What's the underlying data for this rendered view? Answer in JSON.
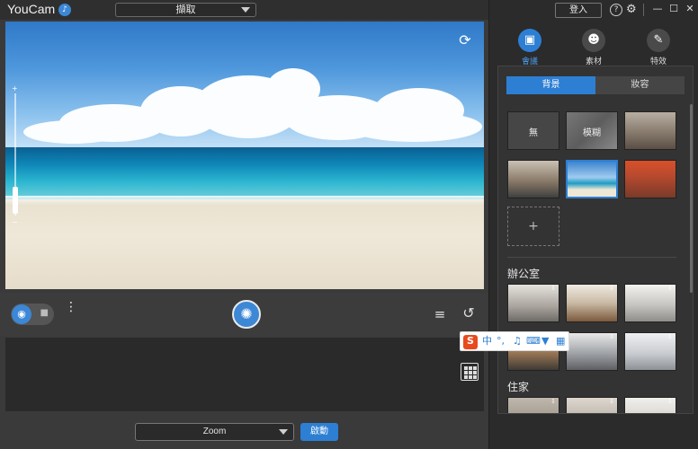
{
  "app": {
    "title": "YouCam"
  },
  "header": {
    "mode": "擷取"
  },
  "window": {
    "login": "登入",
    "help": "?",
    "settings": "⚙",
    "minimize": "—",
    "maximize": "☐",
    "close": "✕"
  },
  "camera": {
    "swap_icon": "camera-switch-icon"
  },
  "controls": {
    "more": "⋮",
    "undo": "↺",
    "layers": "≡"
  },
  "bottom": {
    "zoom_value": "Zoom",
    "start": "啟動"
  },
  "categories": [
    {
      "label": "會議",
      "icon": "meeting-icon",
      "active": true
    },
    {
      "label": "素材",
      "icon": "sticker-icon",
      "active": false
    },
    {
      "label": "特效",
      "icon": "effects-icon",
      "active": false
    }
  ],
  "subtabs": [
    {
      "label": "背景",
      "active": true
    },
    {
      "label": "妝容",
      "active": false
    }
  ],
  "backgrounds": [
    {
      "label": "無"
    },
    {
      "label": "模糊"
    }
  ],
  "add_label": "+",
  "sections": {
    "office": "辦公室",
    "home": "住家"
  },
  "ime": {
    "logo": "S",
    "lang": "中",
    "punct": "°,"
  },
  "colors": {
    "accent": "#2d7fd3",
    "panel": "#333333",
    "background": "#2e2e2e"
  }
}
